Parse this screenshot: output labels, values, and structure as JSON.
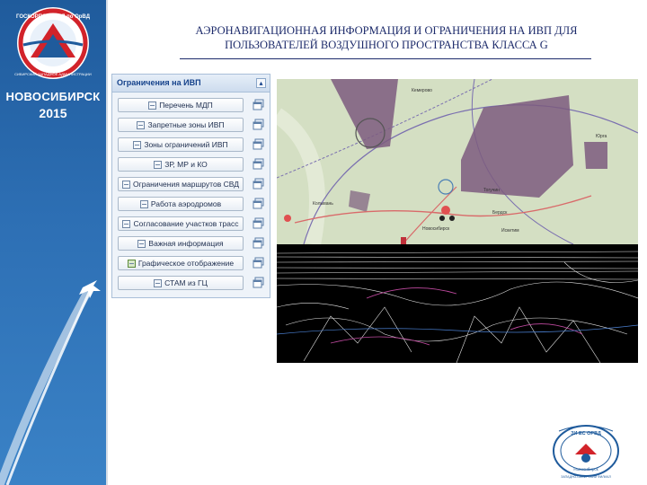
{
  "branding": {
    "logo_arc_text": "ГОСКОРПОРАЦИЯ по ОрВД",
    "logo_sub_text": "СИБИРСКИЙ ЗАПАДНОЕ АДМИНИСТРАЦИИ",
    "city": "НОВОСИБИРСК",
    "year": "2015",
    "colors": {
      "sidebar_blue": "#2d6fb4",
      "logo_red": "#d2232a"
    }
  },
  "title": {
    "line1": "АЭРОНАВИГАЦИОННАЯ ИНФОРМАЦИЯ И ОГРАНИЧЕНИЯ НА ИВП ДЛЯ",
    "line2": "ПОЛЬЗОВАТЕЛЕЙ ВОЗДУШНОГО ПРОСТРАНСТВА КЛАССА G"
  },
  "panel": {
    "title": "Ограничения на ИВП",
    "collapse_icon": "chevron-up-icon",
    "buttons": [
      {
        "label": "Перечень МДП",
        "icon": "table-icon"
      },
      {
        "label": "Запретные зоны ИВП",
        "icon": "table-icon"
      },
      {
        "label": "Зоны ограничений ИВП",
        "icon": "table-icon"
      },
      {
        "label": "ЗР, МР и КО",
        "icon": "table-icon"
      },
      {
        "label": "Ограничения маршрутов СВД",
        "icon": "table-icon"
      },
      {
        "label": "Работа аэродромов",
        "icon": "table-icon"
      },
      {
        "label": "Согласование участков трасс",
        "icon": "table-icon"
      },
      {
        "label": "Важная информация",
        "icon": "table-icon"
      },
      {
        "label": "Графическое отображение",
        "icon": "map-icon"
      },
      {
        "label": "СТАМ из ГЦ",
        "icon": "table-icon"
      }
    ],
    "window_icon": "new-window-icon"
  },
  "map": {
    "colors": {
      "land": "#c9d9b5",
      "zone": "#7d5c7f",
      "boundary": "#7a6fb0",
      "road": "#d96a6a"
    },
    "labels": [
      "Юрга",
      "Кемерово",
      "Новосибирск",
      "Колывань",
      "Бердск",
      "Искитим",
      "Тогучин"
    ]
  },
  "emblem": {
    "arc_text": "ЗАПАДНО-СИБИРСКИЙ ФИЛИАЛ",
    "letters": "ЗИ ЕС ОРВД",
    "bottom_text": "Новосибирск"
  }
}
